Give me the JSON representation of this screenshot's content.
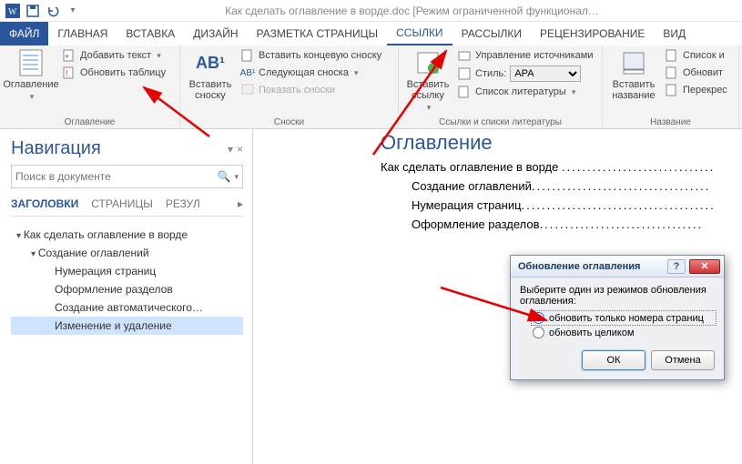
{
  "titlebar": {
    "doc_title": "Как сделать оглавление в ворде.doc [Режим ограниченной функционал…"
  },
  "tabs": {
    "file": "ФАЙЛ",
    "items": [
      "ГЛАВНАЯ",
      "ВСТАВКА",
      "ДИЗАЙН",
      "РАЗМЕТКА СТРАНИЦЫ",
      "ССЫЛКИ",
      "РАССЫЛКИ",
      "РЕЦЕНЗИРОВАНИЕ",
      "ВИД"
    ],
    "active_index": 4
  },
  "ribbon": {
    "g0": {
      "big": "Оглавление",
      "add_text": "Добавить текст",
      "update": "Обновить таблицу",
      "label": "Оглавление"
    },
    "g1": {
      "big": "Вставить сноску",
      "ab": "AB¹",
      "end": "Вставить концевую сноску",
      "next": "Следующая сноска",
      "show": "Показать сноски",
      "label": "Сноски"
    },
    "g2": {
      "big": "Вставить ссылку",
      "manage": "Управление источниками",
      "style_lbl": "Стиль:",
      "style_val": "APA",
      "biblio": "Список литературы",
      "label": "Ссылки и списки литературы"
    },
    "g3": {
      "big": "Вставить название",
      "list": "Список и",
      "update": "Обновит",
      "cross": "Перекрес",
      "label": "Название"
    }
  },
  "nav": {
    "title": "Навигация",
    "search_placeholder": "Поиск в документе",
    "tabs": {
      "headings": "ЗАГОЛОВКИ",
      "pages": "СТРАНИЦЫ",
      "results": "РЕЗУЛ"
    },
    "tree": {
      "n0": "Как сделать оглавление в ворде",
      "n1": "Создание оглавлений",
      "n2a": "Нумерация страниц",
      "n2b": "Оформление разделов",
      "n2c": "Создание автоматического…",
      "n2d": "Изменение и удаление"
    }
  },
  "doc": {
    "heading": "Оглавление",
    "l0": "Как сделать оглавление в ворде",
    "l1": "Создание оглавлений",
    "l2": "Нумерация страниц",
    "l3": "Оформление разделов"
  },
  "dialog": {
    "title": "Обновление оглавления",
    "prompt": "Выберите один из режимов обновления оглавления:",
    "opt1": "обновить только номера страниц",
    "opt2": "обновить целиком",
    "ok": "ОК",
    "cancel": "Отмена"
  }
}
